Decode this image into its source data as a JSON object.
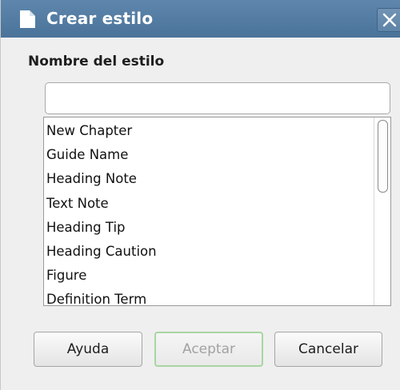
{
  "window": {
    "title": "Crear estilo",
    "close_icon": "close-icon",
    "title_icon": "document-icon"
  },
  "form": {
    "name_label": "Nombre del estilo",
    "name_value": "",
    "name_placeholder": ""
  },
  "styles_list": {
    "items": [
      "New Chapter",
      "Guide Name",
      "Heading Note",
      "Text Note",
      "Heading Tip",
      "Heading Caution",
      "Figure",
      "Definition Term"
    ]
  },
  "buttons": {
    "help_label": "Ayuda",
    "ok_label": "Aceptar",
    "ok_enabled": false,
    "cancel_label": "Cancelar"
  },
  "colors": {
    "titlebar": "#4f789f",
    "default_button_outline": "#a9d5a3"
  }
}
